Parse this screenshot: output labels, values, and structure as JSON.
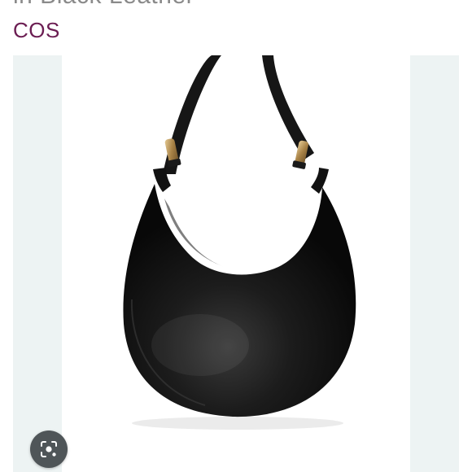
{
  "product": {
    "title_partial": "in Black Leather",
    "brand": "COS",
    "image_alt": "Black leather crescent shoulder bag"
  },
  "controls": {
    "visual_search_icon": "lens-icon"
  },
  "colors": {
    "brand": "#6b1d52",
    "bag": "#141414",
    "hardware": "#b8945a"
  }
}
